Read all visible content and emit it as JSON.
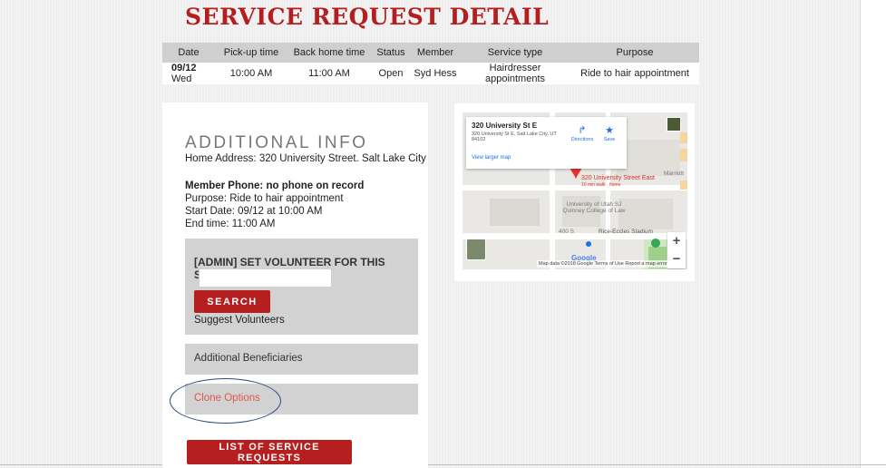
{
  "page": {
    "title": "SERVICE REQUEST DETAIL"
  },
  "table": {
    "headers": [
      "Date",
      "Pick-up time",
      "Back home time",
      "Status",
      "Member",
      "Service type",
      "Purpose"
    ],
    "row": {
      "date_bold": "09/12",
      "date_day": " Wed",
      "pickup": "10:00 AM",
      "back_home": "11:00 AM",
      "status": "Open",
      "member": "Syd Hess",
      "service_type": "Hairdresser appointments",
      "purpose": "Ride to hair appointment"
    }
  },
  "info": {
    "heading": "ADDITIONAL INFO",
    "home_address": "Home Address: 320 University Street. Salt Lake City",
    "member_phone": "Member Phone: no phone on record",
    "purpose": "Purpose: Ride to hair appointment",
    "start_date": "Start Date: 09/12 at 10:00 AM",
    "end_time": "End time: 11:00 AM"
  },
  "admin": {
    "title": "[ADMIN] SET VOLUNTEER FOR THIS SERVICE",
    "input_value": "",
    "search_label": "SEARCH",
    "suggest_label": "Suggest Volunteers"
  },
  "sections": {
    "beneficiaries": "Additional Beneficiaries",
    "clone": "Clone Options"
  },
  "buttons": {
    "list_requests": "LIST OF SERVICE REQUESTS"
  },
  "map": {
    "place_title": "320 University St E",
    "place_address": "320 University St E, Salt Lake City, UT 84102",
    "directions": "Directions",
    "save": "Save",
    "view_larger": "View larger map",
    "pin_label": "320 University Street East",
    "pin_sub": "10 min walk · home",
    "poi_law": "University of Utah SJ Quinney College of Law",
    "poi_stadium": "Rice-Eccles Stadium",
    "poi_marriott": "Marriott",
    "street_400s": "400 S",
    "zoom_in": "+",
    "zoom_out": "−",
    "google": "Google",
    "footer": "Map data ©2018 Google   Terms of Use   Report a map error"
  },
  "colors": {
    "brand_red": "#b31f1f",
    "clone_link": "#e0574f",
    "annotation": "#2c4a86"
  }
}
